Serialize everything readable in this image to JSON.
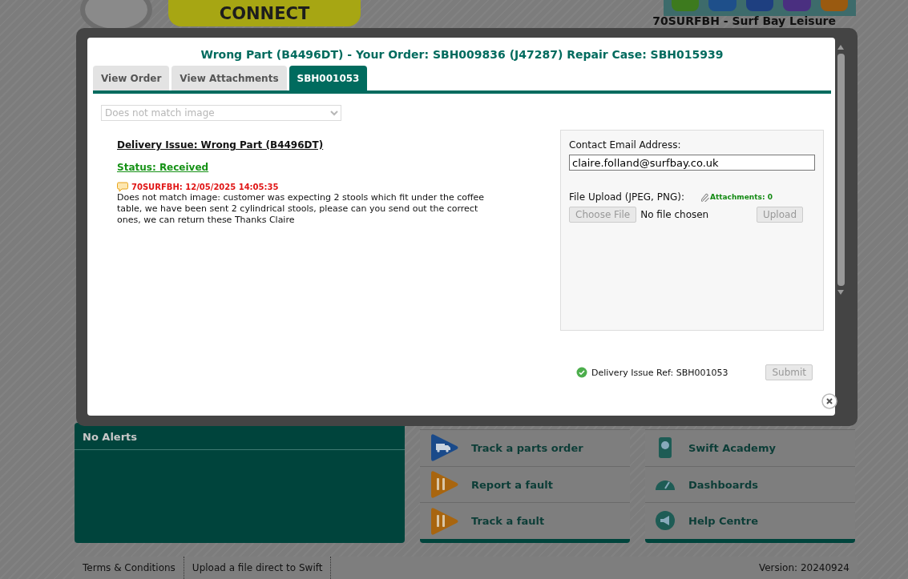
{
  "header": {
    "logo_text": "CONNECT",
    "account": "70SURFBH - Surf Bay Leisure"
  },
  "modal": {
    "title": "Wrong Part (B4496DT) - Your Order: SBH009836 (J47287) Repair Case: SBH015939",
    "tabs": [
      {
        "label": "View Order",
        "selected": false
      },
      {
        "label": "View Attachments",
        "selected": false
      },
      {
        "label": "SBH001053",
        "selected": true
      }
    ],
    "reason_select": {
      "value": "Does not match image",
      "disabled": true
    },
    "issue_heading": "Delivery Issue: Wrong Part (B4496DT)",
    "status": "Status: Received",
    "comment": {
      "author_time": "70SURFBH: 12/05/2025 14:05:35",
      "text": "Does not match image: customer was expecting 2 stools which fit under the coffee table, we have been sent 2 cylindrical stools, please can you send out the correct ones, we can return these Thanks Claire"
    },
    "email": {
      "label": "Contact Email Address:",
      "value": "claire.folland@surfbay.co.uk"
    },
    "upload": {
      "label": "File Upload (JPEG, PNG):",
      "attachments": "Attachments: 0",
      "choose_button": "Choose File",
      "file_status": "No file chosen",
      "upload_button": "Upload",
      "disabled": true
    },
    "ref": "Delivery Issue Ref: SBH001053",
    "submit": {
      "label": "Submit",
      "disabled": true
    }
  },
  "alerts": {
    "title": "No Alerts"
  },
  "menu_left": [
    {
      "label": "Track a parts order",
      "kind": "truck"
    },
    {
      "label": "Report a fault",
      "kind": "tools"
    },
    {
      "label": "Track a fault",
      "kind": "tools"
    }
  ],
  "menu_right": [
    {
      "label": "Swift Academy",
      "kind": "academy"
    },
    {
      "label": "Dashboards",
      "kind": "gauge"
    },
    {
      "label": "Help Centre",
      "kind": "megaphone"
    }
  ],
  "footer": {
    "links": [
      "Terms & Conditions",
      "Upload a file direct to Swift"
    ],
    "version": "Version: 20240924"
  }
}
